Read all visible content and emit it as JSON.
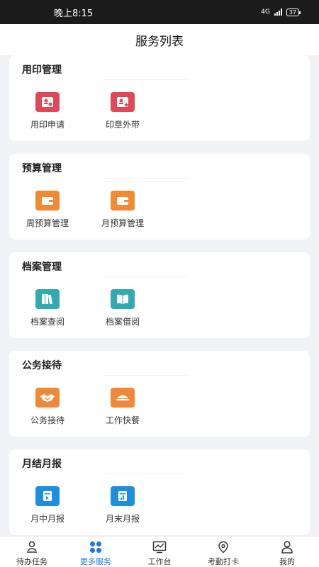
{
  "status_bar": {
    "time": "晚上8:15",
    "network": "4G",
    "battery": "37"
  },
  "header": {
    "title": "服务列表"
  },
  "sections": [
    {
      "title": "用印管理",
      "items": [
        {
          "label": "用印申请",
          "icon": "stamp-apply-icon",
          "color": "#e0485a"
        },
        {
          "label": "印章外带",
          "icon": "stamp-takeout-icon",
          "color": "#e0485a"
        }
      ]
    },
    {
      "title": "预算管理",
      "items": [
        {
          "label": "周预算管理",
          "icon": "wallet-icon",
          "color": "#f28a34"
        },
        {
          "label": "月预算管理",
          "icon": "wallet-icon",
          "color": "#f28a34"
        }
      ]
    },
    {
      "title": "档案管理",
      "items": [
        {
          "label": "档案查阅",
          "icon": "archive-books-icon",
          "color": "#33a9b1"
        },
        {
          "label": "档案借阅",
          "icon": "open-book-icon",
          "color": "#33a9b1"
        }
      ]
    },
    {
      "title": "公务接待",
      "items": [
        {
          "label": "公务接待",
          "icon": "handshake-icon",
          "color": "#f0883a"
        },
        {
          "label": "工作快餐",
          "icon": "meal-icon",
          "color": "#f0883a"
        }
      ]
    },
    {
      "title": "月结月报",
      "items": [
        {
          "label": "月中月报",
          "icon": "report-icon",
          "color": "#1d8fe0"
        },
        {
          "label": "月末月报",
          "icon": "report-icon",
          "color": "#1d8fe0"
        }
      ]
    }
  ],
  "tabbar": [
    {
      "label": "待办任务",
      "icon": "person-stamp-icon"
    },
    {
      "label": "更多服务",
      "icon": "grid-icon"
    },
    {
      "label": "工作台",
      "icon": "monitor-chart-icon"
    },
    {
      "label": "考勤打卡",
      "icon": "location-icon"
    },
    {
      "label": "我的",
      "icon": "user-icon"
    }
  ],
  "active_tab": "更多服务",
  "colors": {
    "accent": "#1e7be3"
  }
}
